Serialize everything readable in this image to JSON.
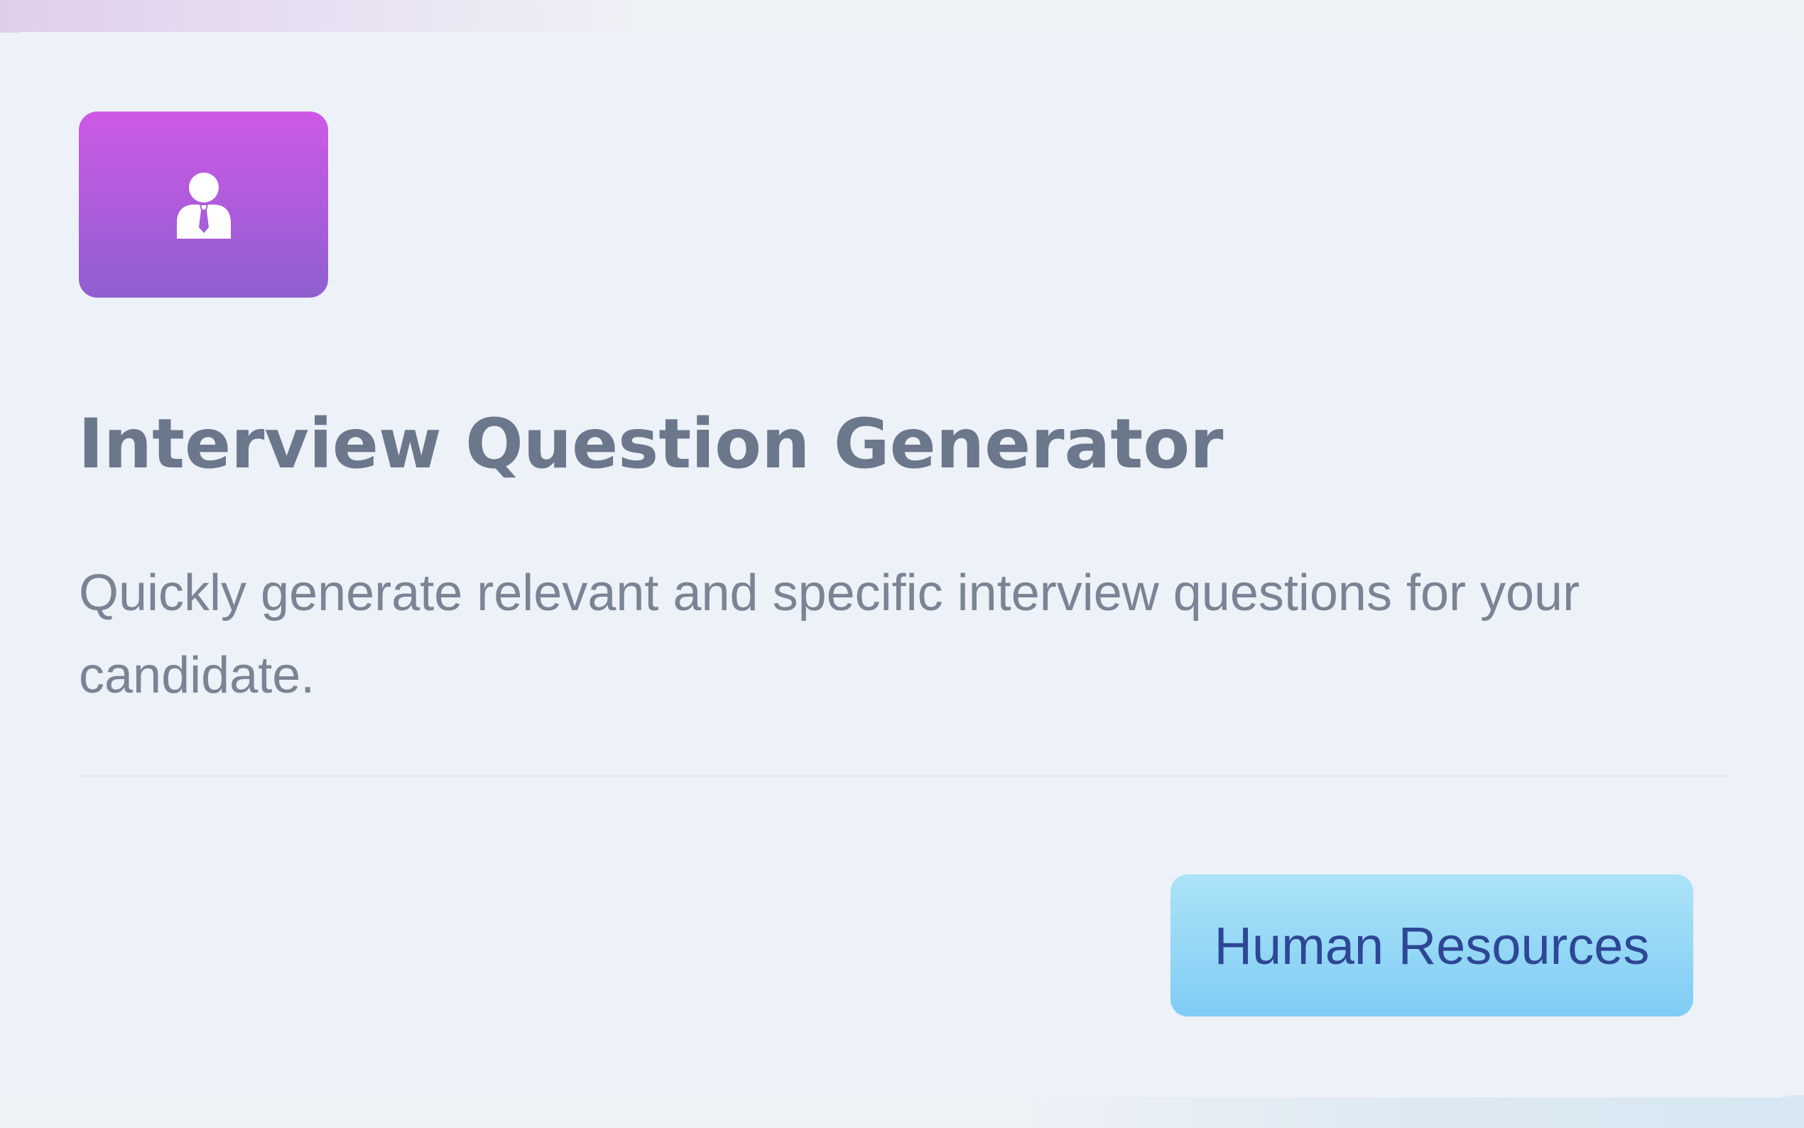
{
  "card": {
    "icon": "user-tie-icon",
    "icon_gradient": [
      "#cd59e6",
      "#8f5fd0"
    ],
    "title": "Interview Question Generator",
    "description": "Quickly generate relevant and specific interview questions for your candidate.",
    "category_tag": "Human Resources",
    "tag_color": "#8fd6f6",
    "tag_text_color": "#2d4795"
  }
}
